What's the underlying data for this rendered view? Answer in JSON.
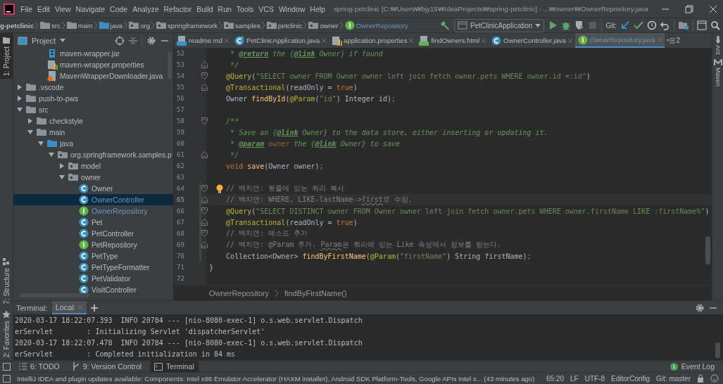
{
  "window": {
    "title": "spring-petclinic [C:₩Users₩bjy15₩IdeaProjects₩spring-petclinic] - ...₩owner₩OwnerRepository.java"
  },
  "menu": [
    "File",
    "Edit",
    "View",
    "Navigate",
    "Code",
    "Analyze",
    "Refactor",
    "Build",
    "Run",
    "Tools",
    "VCS",
    "Window",
    "Help"
  ],
  "nav_path": [
    {
      "label": "g-petclinic",
      "kind": "project"
    },
    {
      "label": "src",
      "kind": "folder"
    },
    {
      "label": "main",
      "kind": "folder"
    },
    {
      "label": "java",
      "kind": "source-folder"
    },
    {
      "label": "org",
      "kind": "package"
    },
    {
      "label": "springframework",
      "kind": "package"
    },
    {
      "label": "samples",
      "kind": "package"
    },
    {
      "label": "petclinic",
      "kind": "package"
    },
    {
      "label": "owner",
      "kind": "package"
    },
    {
      "label": "OwnerRepository",
      "kind": "interface"
    }
  ],
  "run_config": "PetClinicApplication",
  "git_label": "Git:",
  "left_stripe": [
    {
      "label": "1: Project",
      "kind": "project",
      "selected": true
    },
    {
      "label": "7: Structure",
      "kind": "structure",
      "selected": false
    },
    {
      "label": "2: Favorites",
      "kind": "favorites",
      "selected": false
    }
  ],
  "project_panel": {
    "title": "Project",
    "tree_top": [
      {
        "label": "maven-wrapper.jar",
        "kind": "jar",
        "selected": false
      },
      {
        "label": "maven-wrapper.properties",
        "kind": "properties",
        "selected": false
      },
      {
        "label": "MavenWrapperDownloader.java",
        "kind": "java-file",
        "selected": false
      }
    ],
    "tree": [
      {
        "label": ".vscode",
        "kind": "folder",
        "expanded": false,
        "selected": false
      },
      {
        "label": "push-to-pws",
        "kind": "folder",
        "expanded": false,
        "selected": false
      },
      {
        "label": "src",
        "kind": "folder",
        "expanded": true,
        "selected": false,
        "children": [
          {
            "label": "checkstyle",
            "kind": "folder",
            "expanded": false,
            "selected": false
          },
          {
            "label": "main",
            "kind": "folder",
            "expanded": true,
            "selected": false,
            "children": [
              {
                "label": "java",
                "kind": "source-folder",
                "expanded": true,
                "selected": false,
                "children": [
                  {
                    "label": "org.springframework.samples.p",
                    "kind": "package",
                    "expanded": true,
                    "selected": false,
                    "children": [
                      {
                        "label": "model",
                        "kind": "package",
                        "expanded": false,
                        "selected": false
                      },
                      {
                        "label": "owner",
                        "kind": "package",
                        "expanded": true,
                        "selected": false,
                        "children": [
                          {
                            "label": "Owner",
                            "kind": "class",
                            "selected": false,
                            "modified": false
                          },
                          {
                            "label": "OwnerController",
                            "kind": "class",
                            "selected": true,
                            "modified": true
                          },
                          {
                            "label": "OwnerRepository",
                            "kind": "interface",
                            "selected": false,
                            "modified": true
                          },
                          {
                            "label": "Pet",
                            "kind": "class",
                            "selected": false,
                            "modified": false
                          },
                          {
                            "label": "PetController",
                            "kind": "class",
                            "selected": false,
                            "modified": false
                          },
                          {
                            "label": "PetRepository",
                            "kind": "interface",
                            "selected": false,
                            "modified": false
                          },
                          {
                            "label": "PetType",
                            "kind": "class",
                            "selected": false,
                            "modified": false
                          },
                          {
                            "label": "PetTypeFormatter",
                            "kind": "class",
                            "selected": false,
                            "modified": false
                          },
                          {
                            "label": "PetValidator",
                            "kind": "class",
                            "selected": false,
                            "modified": false
                          },
                          {
                            "label": "VisitController",
                            "kind": "class",
                            "selected": false,
                            "modified": false
                          }
                        ]
                      }
                    ]
                  }
                ]
              }
            ]
          }
        ]
      }
    ]
  },
  "editor": {
    "tabs": [
      {
        "label": "readme.md",
        "kind": "md",
        "selected": false
      },
      {
        "label": "PetClinicApplication.java",
        "kind": "class-run",
        "selected": false
      },
      {
        "label": "application.properties",
        "kind": "properties",
        "selected": false
      },
      {
        "label": "findOwners.html",
        "kind": "html",
        "selected": false
      },
      {
        "label": "OwnerController.java",
        "kind": "class",
        "selected": false
      },
      {
        "label": "OwnerRepository.java",
        "kind": "interface",
        "selected": true
      }
    ],
    "tab_overflow": "2",
    "lines": [
      {
        "number": "52",
        "changed": false,
        "current": false,
        "bulb": false,
        "tokens": [
          {
            "text": "     * ",
            "kind": "doc"
          },
          {
            "text": "@return",
            "kind": "doctag"
          },
          {
            "text": " the {",
            "kind": "doc"
          },
          {
            "text": "@link",
            "kind": "doctag"
          },
          {
            "text": " Owner} if found",
            "kind": "doc"
          }
        ]
      },
      {
        "number": "53",
        "changed": false,
        "current": false,
        "bulb": false,
        "fold_close": true,
        "tokens": [
          {
            "text": "     */",
            "kind": "doc"
          }
        ]
      },
      {
        "number": "54",
        "changed": false,
        "current": false,
        "bulb": false,
        "fold_open": true,
        "tokens": [
          {
            "text": "    @Query",
            "kind": "annotation"
          },
          {
            "text": "(",
            "kind": "plain"
          },
          {
            "text": "\"SELECT owner FROM Owner owner left join fetch owner.pets WHERE owner.id =:id\"",
            "kind": "string"
          },
          {
            "text": ")",
            "kind": "plain"
          }
        ]
      },
      {
        "number": "55",
        "changed": false,
        "current": false,
        "bulb": false,
        "fold_close": true,
        "tokens": [
          {
            "text": "    @Transactional",
            "kind": "annotation"
          },
          {
            "text": "(readOnly = ",
            "kind": "plain"
          },
          {
            "text": "true",
            "kind": "keyword"
          },
          {
            "text": ")",
            "kind": "plain"
          }
        ]
      },
      {
        "number": "56",
        "changed": false,
        "current": false,
        "bulb": false,
        "tokens": [
          {
            "text": "    Owner ",
            "kind": "plain"
          },
          {
            "text": "findById",
            "kind": "method"
          },
          {
            "text": "(",
            "kind": "plain"
          },
          {
            "text": "@Param",
            "kind": "annotation"
          },
          {
            "text": "(",
            "kind": "plain"
          },
          {
            "text": "\"id\"",
            "kind": "string"
          },
          {
            "text": ") Integer id)",
            "kind": "plain"
          },
          {
            "text": ";",
            "kind": "keyword"
          }
        ]
      },
      {
        "number": "57",
        "changed": false,
        "current": false,
        "bulb": false
      },
      {
        "number": "58",
        "changed": false,
        "current": false,
        "bulb": false,
        "fold_open": true,
        "tokens": [
          {
            "text": "    /**",
            "kind": "doc"
          }
        ]
      },
      {
        "number": "59",
        "changed": false,
        "current": false,
        "bulb": false,
        "tokens": [
          {
            "text": "     * Save an {",
            "kind": "doc"
          },
          {
            "text": "@link",
            "kind": "doctag"
          },
          {
            "text": " Owner} to the data store, either inserting or updating it.",
            "kind": "doc"
          }
        ]
      },
      {
        "number": "60",
        "changed": false,
        "current": false,
        "bulb": false,
        "tokens": [
          {
            "text": "     * ",
            "kind": "doc"
          },
          {
            "text": "@param",
            "kind": "doctag"
          },
          {
            "text": " owner",
            "kind": "paramdoc"
          },
          {
            "text": " the {",
            "kind": "doc"
          },
          {
            "text": "@link",
            "kind": "doctag"
          },
          {
            "text": " Owner} to save",
            "kind": "doc"
          }
        ]
      },
      {
        "number": "61",
        "changed": false,
        "current": false,
        "bulb": false,
        "fold_close": true,
        "tokens": [
          {
            "text": "     */",
            "kind": "doc"
          }
        ]
      },
      {
        "number": "62",
        "changed": false,
        "current": false,
        "bulb": false,
        "tokens": [
          {
            "text": "    void ",
            "kind": "keyword"
          },
          {
            "text": "save",
            "kind": "method"
          },
          {
            "text": "(Owner owner)",
            "kind": "plain"
          },
          {
            "text": ";",
            "kind": "keyword"
          }
        ]
      },
      {
        "number": "63",
        "changed": false,
        "current": false,
        "bulb": false
      },
      {
        "number": "64",
        "changed": true,
        "current": false,
        "bulb": true,
        "fold_open": true,
        "tokens": [
          {
            "text": "    // 백지연: 윗줄에 있는 쿼리 복사",
            "kind": "comment"
          }
        ]
      },
      {
        "number": "65",
        "changed": true,
        "current": true,
        "bulb": false,
        "fold_close": true,
        "tokens": [
          {
            "text": "    // 백지연: WHERE, LIKE-lastName->",
            "kind": "comment"
          },
          {
            "text": "first",
            "kind": "typo"
          },
          {
            "text": "로 수정.",
            "kind": "comment"
          }
        ]
      },
      {
        "number": "66",
        "changed": true,
        "current": false,
        "bulb": false,
        "fold_open": true,
        "tokens": [
          {
            "text": "    @Query",
            "kind": "annotation"
          },
          {
            "text": "(",
            "kind": "plain"
          },
          {
            "text": "\"SELECT DISTINCT owner FROM Owner owner left join fetch owner.pets WHERE owner.firstName LIKE :firstName%\"",
            "kind": "string"
          },
          {
            "text": ")",
            "kind": "plain"
          }
        ]
      },
      {
        "number": "67",
        "changed": true,
        "current": false,
        "bulb": false,
        "fold_close": true,
        "tokens": [
          {
            "text": "    @Transactional",
            "kind": "annotation"
          },
          {
            "text": "(readOnly = ",
            "kind": "plain"
          },
          {
            "text": "true",
            "kind": "keyword"
          },
          {
            "text": ")",
            "kind": "plain"
          }
        ]
      },
      {
        "number": "68",
        "changed": true,
        "current": false,
        "bulb": false,
        "fold_open": true,
        "tokens": [
          {
            "text": "    // 백지연: 메소드 추가",
            "kind": "comment"
          }
        ]
      },
      {
        "number": "69",
        "changed": true,
        "current": false,
        "bulb": false,
        "fold_close": true,
        "tokens": [
          {
            "text": "    // 백지연: @Param 추가. ",
            "kind": "comment"
          },
          {
            "text": "Param",
            "kind": "typo"
          },
          {
            "text": "은 쿼리에 있는 Like 속성에서 정보를 받는다.",
            "kind": "comment"
          }
        ]
      },
      {
        "number": "70",
        "changed": true,
        "current": false,
        "bulb": false,
        "tokens": [
          {
            "text": "    Collection<Owner> ",
            "kind": "plain"
          },
          {
            "text": "findByFirstName",
            "kind": "method"
          },
          {
            "text": "(",
            "kind": "plain"
          },
          {
            "text": "@Param",
            "kind": "annotation"
          },
          {
            "text": "(",
            "kind": "plain"
          },
          {
            "text": "\"firstName\"",
            "kind": "string"
          },
          {
            "text": ") String firstName)",
            "kind": "plain"
          },
          {
            "text": ";",
            "kind": "keyword"
          }
        ]
      },
      {
        "number": "71",
        "changed": false,
        "current": false,
        "bulb": false,
        "tokens": [
          {
            "text": "}",
            "kind": "plain"
          }
        ]
      },
      {
        "number": "72",
        "changed": false,
        "current": false,
        "bulb": false
      }
    ],
    "breadcrumb": [
      "OwnerRepository",
      "findByFirstName()"
    ]
  },
  "right_stripe": [
    {
      "label": "Ant",
      "kind": "ant"
    },
    {
      "label": "Maven",
      "kind": "maven"
    }
  ],
  "terminal": {
    "title": "Terminal:",
    "tabs": [
      {
        "label": "Local",
        "selected": true
      }
    ],
    "lines": [
      "2020-03-17 18:22:07.393  INFO 20784 --- [nio-8080-exec-1] o.s.web.servlet.Dispatch",
      "erServlet        : Initializing Servlet 'dispatcherServlet'",
      "2020-03-17 18:22:07.478  INFO 20784 --- [nio-8080-exec-1] o.s.web.servlet.Dispatch",
      "erServlet        : Completed initialization in 84 ms"
    ]
  },
  "tool_buttons": [
    {
      "label": "6: TODO",
      "kind": "todo",
      "selected": false
    },
    {
      "label": "9: Version Control",
      "kind": "vcs",
      "selected": false
    },
    {
      "label": "Terminal",
      "kind": "terminal",
      "selected": true
    }
  ],
  "event_log": {
    "label": "Event Log",
    "badge": "1"
  },
  "status_bar": {
    "message": "IntelliJ IDEA and plugin updates available: Components: Intel x86 Emulator Accelerator (HAXM installer), Android SDK Platform-Tools, Google APIs Intel x... (43 minutes ago)",
    "items": [
      "65:20",
      "LF",
      "UTF-8",
      "EditorConfig",
      "Git: master"
    ]
  }
}
